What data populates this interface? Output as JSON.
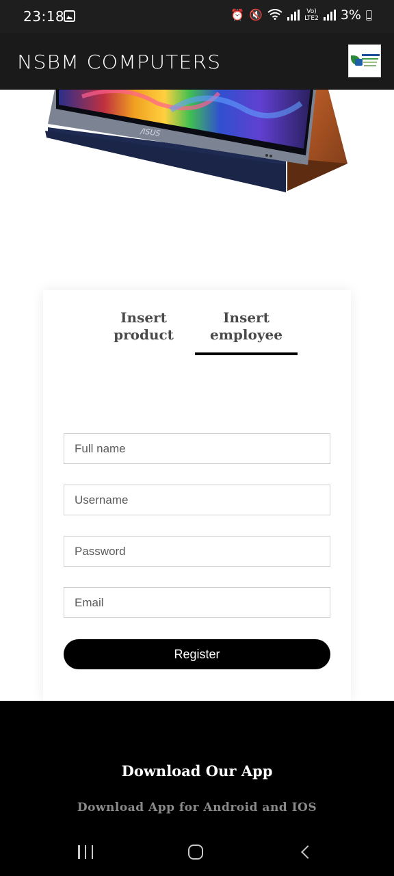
{
  "status_bar": {
    "time": "23:18",
    "battery": "3%",
    "network_label": "LTE2",
    "volte_label": "Vo)",
    "icons": [
      "gallery-icon",
      "alarm-icon",
      "mute-icon",
      "wifi-icon",
      "signal-icon",
      "battery-icon"
    ]
  },
  "app_bar": {
    "title": "NSBM COMPUTERS"
  },
  "hero": {
    "brand_mark": "/ISUS"
  },
  "tabs": [
    {
      "label_line1": "Insert",
      "label_line2": "product",
      "selected": false
    },
    {
      "label_line1": "Insert",
      "label_line2": "employee",
      "selected": true
    }
  ],
  "form": {
    "fullname_placeholder": "Full name",
    "username_placeholder": "Username",
    "password_placeholder": "Password",
    "email_placeholder": "Email",
    "register_label": "Register"
  },
  "footer": {
    "title": "Download Our App",
    "subtitle": "Download App for Android and IOS"
  },
  "colors": {
    "app_bar": "#1a1a1a",
    "button": "#000000",
    "tab_text": "#4a4a4a",
    "footer": "#000000"
  }
}
